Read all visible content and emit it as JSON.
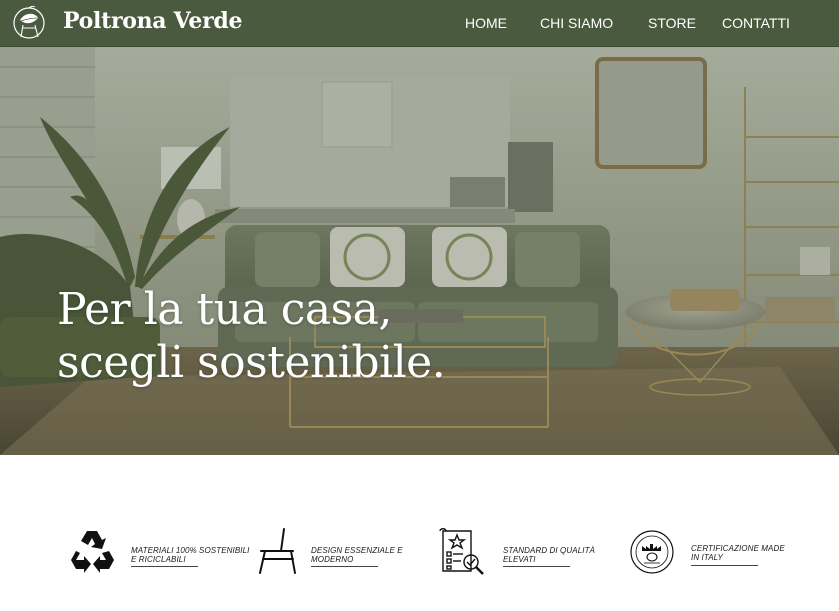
{
  "header": {
    "brand": "Poltrona Verde",
    "logo_icon": "leaf-chair-logo",
    "nav": [
      {
        "label": "HOME"
      },
      {
        "label": "CHI SIAMO"
      },
      {
        "label": "STORE"
      },
      {
        "label": "CONTATTI"
      }
    ]
  },
  "hero": {
    "title_line1": "Per la tua casa,",
    "title_line2": "scegli sostenibile.",
    "image": "living-room-photo"
  },
  "features": [
    {
      "icon": "recycle-icon",
      "text": "MATERIALI 100% SOSTENIBILI E RICICLABILI"
    },
    {
      "icon": "chair-icon",
      "text": "DESIGN ESSENZIALE E MODERNO"
    },
    {
      "icon": "quality-checklist-icon",
      "text": "STANDARD DI QUALITÀ ELEVATI"
    },
    {
      "icon": "made-in-italy-seal-icon",
      "text": "CERTIFICAZIONE MADE IN ITALY"
    }
  ],
  "colors": {
    "header_bg": "#4a5a3f",
    "hero_tint": "#55604a",
    "text_white": "#ffffff"
  }
}
